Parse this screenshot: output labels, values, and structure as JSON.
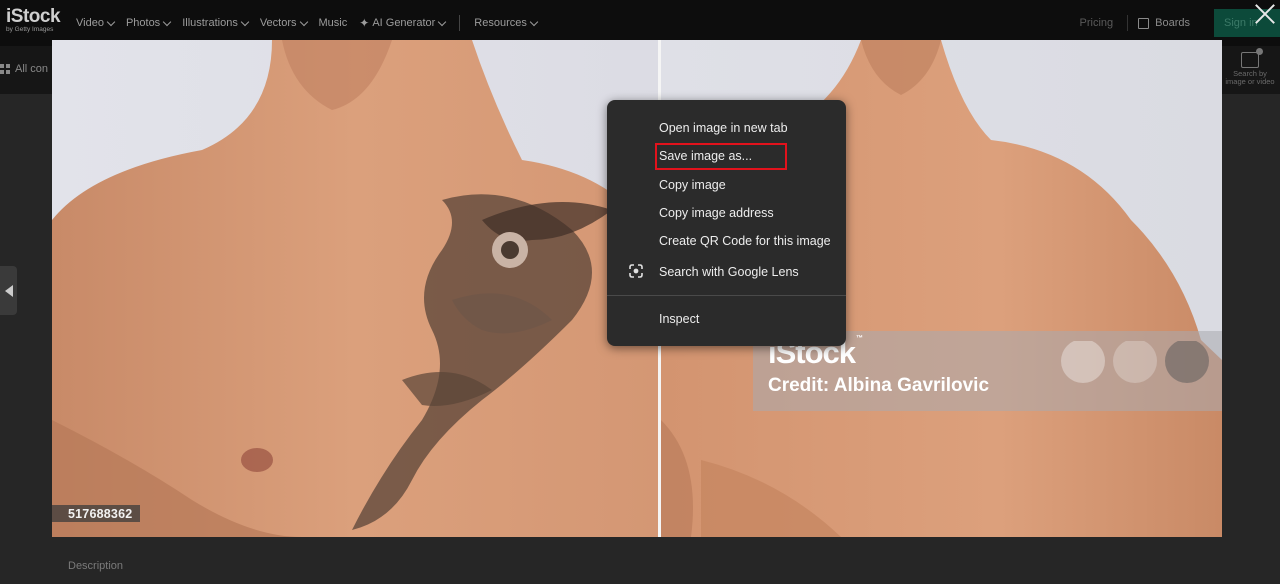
{
  "nav": {
    "logo": "iStock",
    "logo_sub": "by Getty Images",
    "items": [
      {
        "label": "Video"
      },
      {
        "label": "Photos"
      },
      {
        "label": "Illustrations"
      },
      {
        "label": "Vectors"
      },
      {
        "label": "Music"
      },
      {
        "label": "AI Generator"
      },
      {
        "label": "Resources"
      }
    ],
    "pricing": "Pricing",
    "boards": "Boards",
    "sign_in": "Sign in"
  },
  "subbar": {
    "all_content": "All con",
    "search_by_image": "Search by image or video"
  },
  "page": {
    "description_heading": "Description"
  },
  "image": {
    "id": "517688362",
    "watermark_logo": "iStock",
    "watermark_tm": "™",
    "watermark_credit": "Credit: Albina Gavrilovic"
  },
  "context_menu": {
    "items": [
      {
        "label": "Open image in new tab"
      },
      {
        "label": "Save image as..."
      },
      {
        "label": "Copy image"
      },
      {
        "label": "Copy image address"
      },
      {
        "label": "Create QR Code for this image"
      },
      {
        "label": "Search with Google Lens"
      },
      {
        "label": "Inspect"
      }
    ],
    "highlighted_index": 1
  },
  "colors": {
    "nav_bg": "#0d0d0d",
    "menu_bg": "#2b2b2b",
    "highlight_border": "#e3121c",
    "sign_in_bg": "#0c4a3a"
  }
}
